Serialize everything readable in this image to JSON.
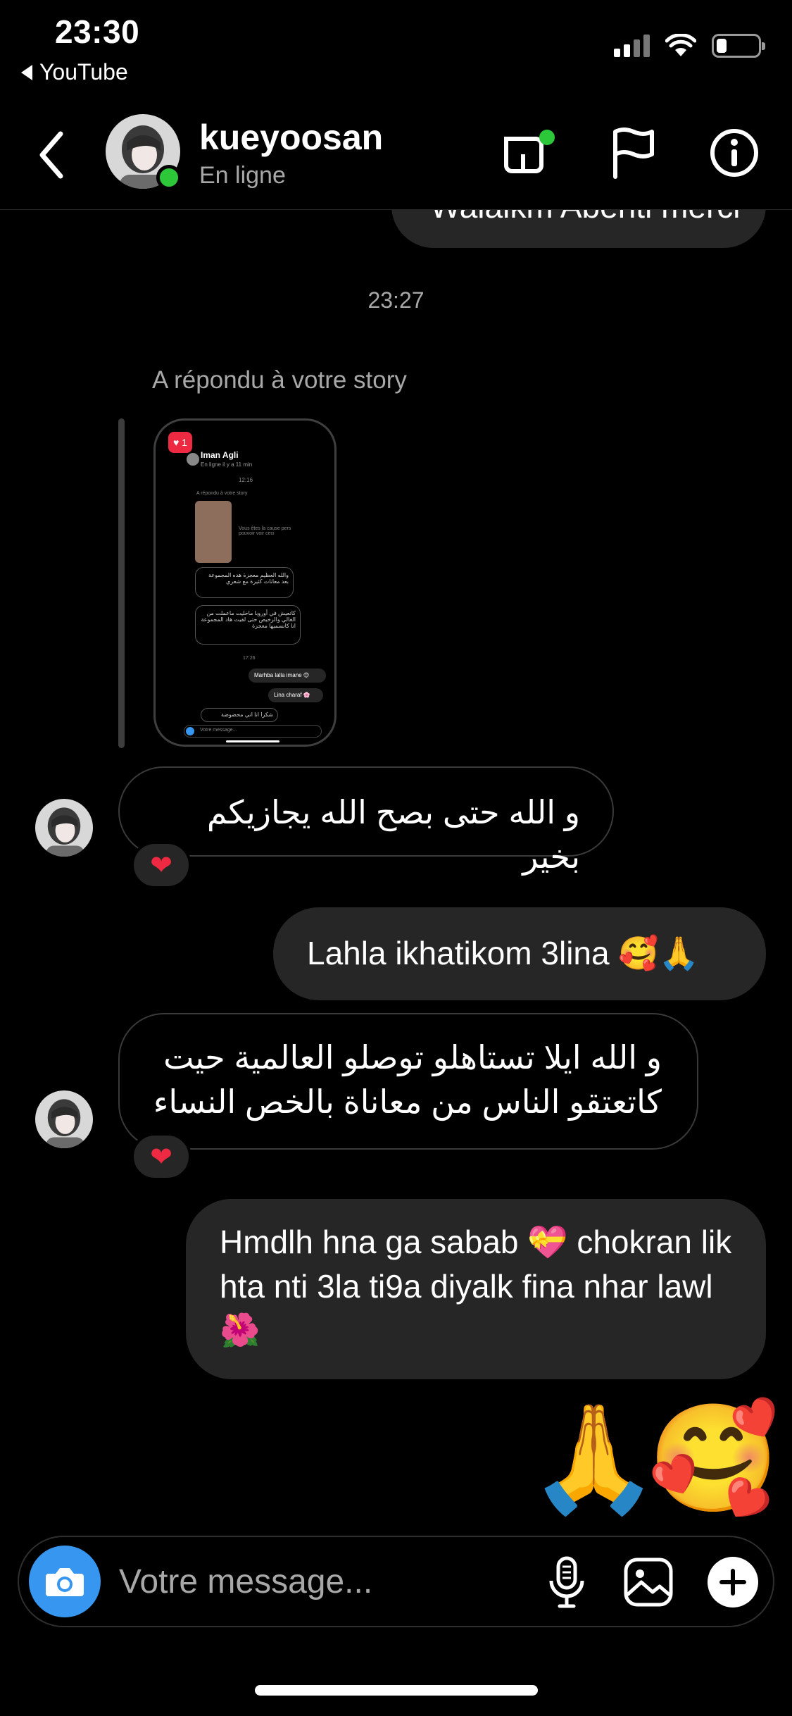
{
  "status_bar": {
    "time": "23:30",
    "back_app": "YouTube",
    "icons": [
      "signal-icon",
      "wifi-icon",
      "battery-icon"
    ]
  },
  "header": {
    "username": "kueyoosan",
    "presence": "En ligne",
    "icons": [
      "back-chevron-icon",
      "video-call-icon",
      "flag-icon",
      "info-icon"
    ]
  },
  "chat": {
    "previous_out_partial": "Walaikm Abenti merci",
    "timestamp": "23:27",
    "story_reply_label": "A répondu à votre story",
    "story_preview": {
      "like_badge": "1",
      "name": "Iman Agli",
      "status": "En ligne il y a 11 min",
      "time": "12:16",
      "replied": "A répondu à votre story",
      "caption": "Vous êtes la cause pers pouvoir voir ceci",
      "msg1": "والله العظيم معجزة هده المجموعة بعد معانات كثيرة مع شعري",
      "msg2": "كانعيش في أوروبا ماخليت ماعملت من الغالي والرخيص حتى لقيت هاد المجموعة انا كانسميها معجزة",
      "time2": "17:26",
      "out1": "Marhba lalla imane 😊",
      "out2": "Lina charaf 🌸",
      "last": "شكرا انا اني محضوضة",
      "composer": "Votre message..."
    },
    "messages": [
      {
        "text": "و الله حتى بصح الله يجازيكم بخير",
        "reaction": "❤"
      },
      {
        "text": "Lahla ikhatikom 3lina 🥰🙏"
      },
      {
        "text": "و الله ايلا تستاهلو توصلو العالمية حيت كاتعتقو الناس من معاناة بالخص النساء",
        "reaction": "❤"
      },
      {
        "text": "Hmdlh hna ga sabab 💝  chokran lik hta nti 3la ti9a diyalk fina nhar lawl 🌺"
      }
    ],
    "big_emojis": [
      "🙏",
      "🥰"
    ]
  },
  "composer": {
    "placeholder": "Votre message...",
    "icons": [
      "camera-icon",
      "microphone-icon",
      "gallery-icon",
      "plus-icon"
    ]
  },
  "colors": {
    "background": "#000000",
    "outgoing_bubble": "#262626",
    "secondary_text": "#a8a8a8",
    "online_green": "#2cc83a",
    "camera_blue": "#3797f0",
    "heart_red": "#ed2a41"
  }
}
